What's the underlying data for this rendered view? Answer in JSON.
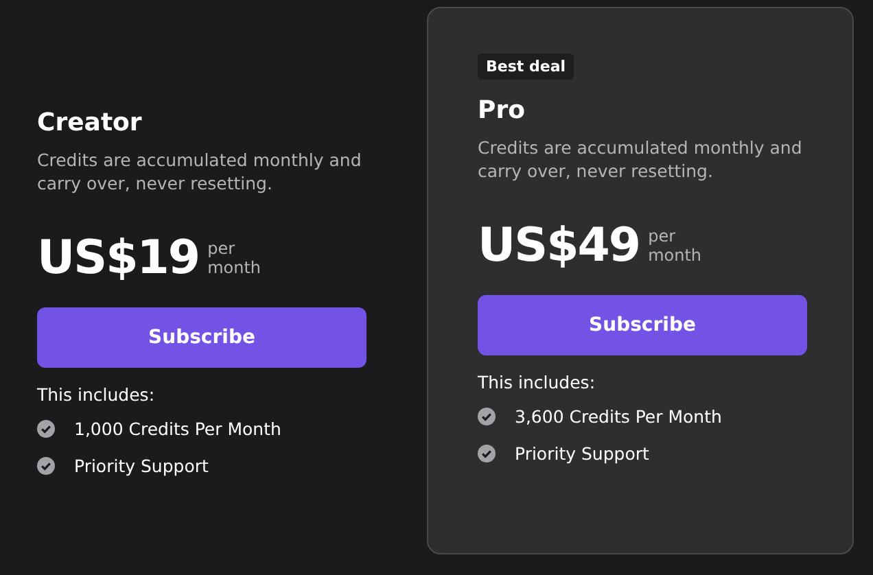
{
  "plans": [
    {
      "name": "Creator",
      "highlighted": false,
      "description": "Credits are accumulated monthly and carry over, never resetting.",
      "price": "US$19",
      "period_top": "per",
      "period_bottom": "month",
      "button": "Subscribe",
      "includes_label": "This includes:",
      "features": [
        "1,000 Credits Per Month",
        "Priority Support"
      ]
    },
    {
      "name": "Pro",
      "highlighted": true,
      "badge": "Best deal",
      "description": "Credits are accumulated monthly and carry over, never resetting.",
      "price": "US$49",
      "period_top": "per",
      "period_bottom": "month",
      "button": "Subscribe",
      "includes_label": "This includes:",
      "features": [
        "3,600 Credits Per Month",
        "Priority Support"
      ]
    }
  ]
}
